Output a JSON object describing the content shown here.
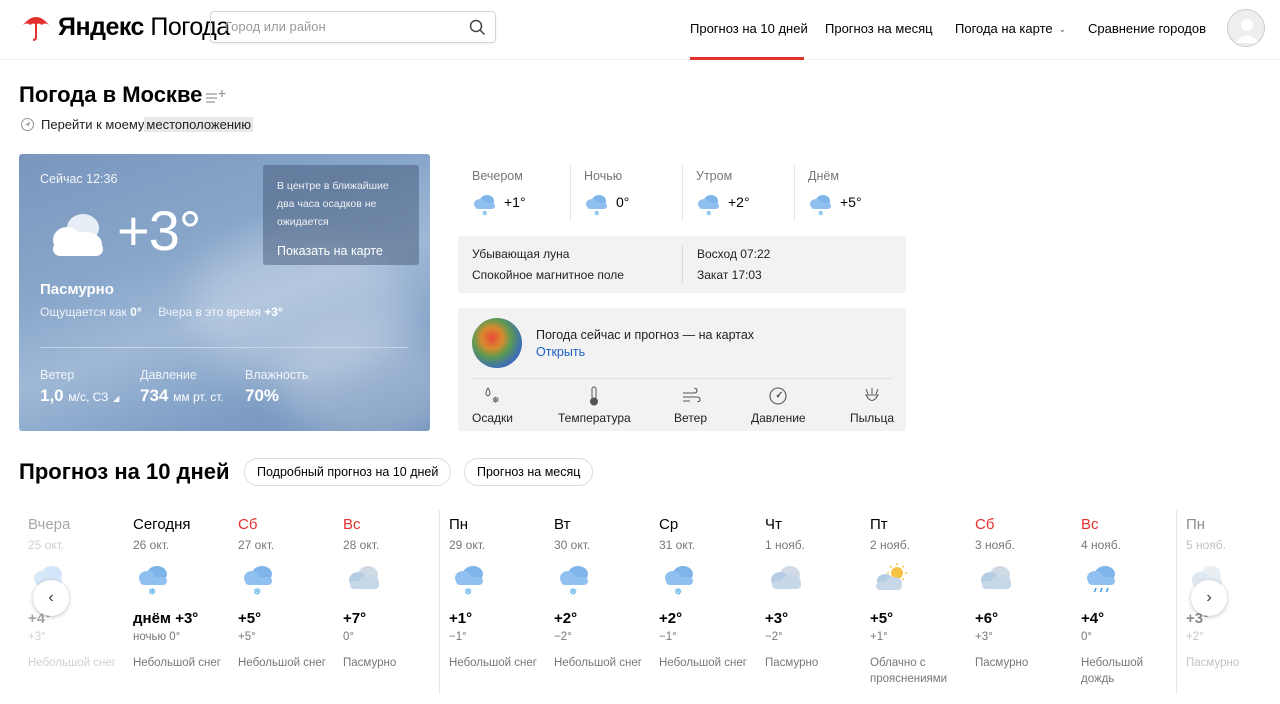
{
  "header": {
    "logo_brand": "Яндекс",
    "logo_product": "Погода",
    "search_placeholder": "Город или район",
    "nav": [
      {
        "label": "Прогноз на 10 дней",
        "active": true
      },
      {
        "label": "Прогноз на месяц"
      },
      {
        "label": "Погода на карте"
      },
      {
        "label": "Сравнение городов"
      }
    ],
    "accent_color": "#e2302d"
  },
  "title": {
    "text": "Погода в Москве",
    "geo_prefix": "Перейти к моему ",
    "geo_link": "местоположению"
  },
  "now": {
    "time": "Сейчас 12:36",
    "temp": "+3°",
    "condition": "Пасмурно",
    "feels_label": "Ощущается как",
    "feels_value": "0°",
    "yesterday_label": "Вчера в это время",
    "yesterday_value": "+3°",
    "precip_text": "В центре в ближайшие два часа осадков не ожидается",
    "precip_button": "Показать на карте",
    "stats": [
      {
        "label": "Ветер",
        "value": "1,0",
        "unit": "м/с, СЗ"
      },
      {
        "label": "Давление",
        "value": "734",
        "unit": "мм рт. ст."
      },
      {
        "label": "Влажность",
        "value": "70%",
        "unit": ""
      }
    ]
  },
  "dayparts": [
    {
      "label": "Вечером",
      "temp": "+1°",
      "icon": "cloud-snow-icon"
    },
    {
      "label": "Ночью",
      "temp": "0°",
      "icon": "cloud-snow-icon"
    },
    {
      "label": "Утром",
      "temp": "+2°",
      "icon": "cloud-snow-icon"
    },
    {
      "label": "Днём",
      "temp": "+5°",
      "icon": "cloud-snow-icon"
    }
  ],
  "astro": {
    "moon": "Убывающая луна",
    "magnetic": "Спокойное магнитное поле",
    "sunrise": "Восход 07:22",
    "sunset": "Закат 17:03"
  },
  "maps": {
    "title": "Погода сейчас и прогноз — на картах",
    "open": "Открыть",
    "layers": [
      "Осадки",
      "Температура",
      "Ветер",
      "Давление",
      "Пыльца"
    ]
  },
  "forecast": {
    "title": "Прогноз на 10 дней",
    "detailed_button": "Подробный прогноз на 10 дней",
    "month_button": "Прогноз на месяц",
    "days": [
      {
        "day": "Вчера",
        "date": "25 окт.",
        "hi": "+4°",
        "lo": "+3°",
        "cond": "Небольшой снег",
        "icon": "cloud-snow"
      },
      {
        "day": "Сегодня",
        "date": "26 окт.",
        "hi": "днём +3°",
        "lo": "ночью 0°",
        "cond": "Небольшой снег",
        "icon": "cloud-snow"
      },
      {
        "day": "Сб",
        "date": "27 окт.",
        "hi": "+5°",
        "lo": "+5°",
        "cond": "Небольшой снег",
        "icon": "cloud-snow"
      },
      {
        "day": "Вс",
        "date": "28 окт.",
        "hi": "+7°",
        "lo": "0°",
        "cond": "Пасмурно",
        "icon": "overcast"
      },
      {
        "day": "Пн",
        "date": "29 окт.",
        "hi": "+1°",
        "lo": "−1°",
        "cond": "Небольшой снег",
        "icon": "cloud-snow"
      },
      {
        "day": "Вт",
        "date": "30 окт.",
        "hi": "+2°",
        "lo": "−2°",
        "cond": "Небольшой снег",
        "icon": "cloud-snow"
      },
      {
        "day": "Ср",
        "date": "31 окт.",
        "hi": "+2°",
        "lo": "−1°",
        "cond": "Небольшой снег",
        "icon": "cloud-snow"
      },
      {
        "day": "Чт",
        "date": "1 нояб.",
        "hi": "+3°",
        "lo": "−2°",
        "cond": "Пасмурно",
        "icon": "overcast"
      },
      {
        "day": "Пт",
        "date": "2 нояб.",
        "hi": "+5°",
        "lo": "+1°",
        "cond": "Облачно с прояснениями",
        "icon": "partly-cloudy"
      },
      {
        "day": "Сб",
        "date": "3 нояб.",
        "hi": "+6°",
        "lo": "+3°",
        "cond": "Пасмурно",
        "icon": "overcast"
      },
      {
        "day": "Вс",
        "date": "4 нояб.",
        "hi": "+4°",
        "lo": "0°",
        "cond": "Небольшой дождь",
        "icon": "cloud-rain"
      },
      {
        "day": "Пн",
        "date": "5 нояб.",
        "hi": "+3°",
        "lo": "+2°",
        "cond": "Пасмурно",
        "icon": "overcast"
      }
    ]
  }
}
